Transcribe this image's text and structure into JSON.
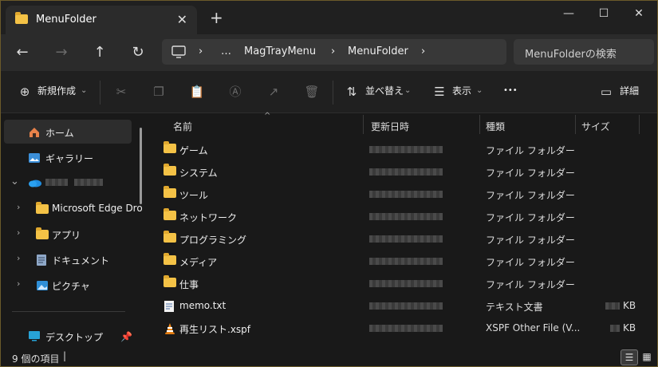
{
  "window": {
    "tab_title": "MenuFolder",
    "tab_close": "✕",
    "new_tab": "+",
    "minimize": "—",
    "maximize": "☐",
    "close": "✕"
  },
  "address": {
    "breadcrumb": [
      "…",
      "MagTrayMenu",
      "MenuFolder"
    ],
    "search_placeholder": "MenuFolderの検索"
  },
  "toolbar": {
    "new_label": "新規作成",
    "sort_label": "並べ替え",
    "view_label": "表示",
    "more_label": "•••",
    "details_label": "詳細"
  },
  "sidebar": {
    "items": [
      {
        "label": "ホーム",
        "icon": "home-icon"
      },
      {
        "label": "ギャラリー",
        "icon": "gallery-icon"
      },
      {
        "label": "",
        "icon": "onedrive-icon"
      },
      {
        "label": "Microsoft Edge Dro",
        "icon": "folder-icon"
      },
      {
        "label": "アプリ",
        "icon": "folder-icon"
      },
      {
        "label": "ドキュメント",
        "icon": "documents-icon"
      },
      {
        "label": "ピクチャ",
        "icon": "pictures-icon"
      },
      {
        "label": "デスクトップ",
        "icon": "desktop-icon"
      }
    ]
  },
  "columns": {
    "name": "名前",
    "date": "更新日時",
    "type": "種類",
    "size": "サイズ"
  },
  "files": [
    {
      "name": "ゲーム",
      "type": "ファイル フォルダー",
      "size": "",
      "icon": "folder-icon"
    },
    {
      "name": "システム",
      "type": "ファイル フォルダー",
      "size": "",
      "icon": "folder-icon"
    },
    {
      "name": "ツール",
      "type": "ファイル フォルダー",
      "size": "",
      "icon": "folder-icon"
    },
    {
      "name": "ネットワーク",
      "type": "ファイル フォルダー",
      "size": "",
      "icon": "folder-icon"
    },
    {
      "name": "プログラミング",
      "type": "ファイル フォルダー",
      "size": "",
      "icon": "folder-icon"
    },
    {
      "name": "メディア",
      "type": "ファイル フォルダー",
      "size": "",
      "icon": "folder-icon"
    },
    {
      "name": "仕事",
      "type": "ファイル フォルダー",
      "size": "",
      "icon": "folder-icon"
    },
    {
      "name": "memo.txt",
      "type": "テキスト文書",
      "size": "KB",
      "icon": "text-file-icon"
    },
    {
      "name": "再生リスト.xspf",
      "type": "XSPF Other File (V...",
      "size": "KB",
      "icon": "vlc-icon"
    }
  ],
  "status": {
    "count": "9 個の項目"
  }
}
